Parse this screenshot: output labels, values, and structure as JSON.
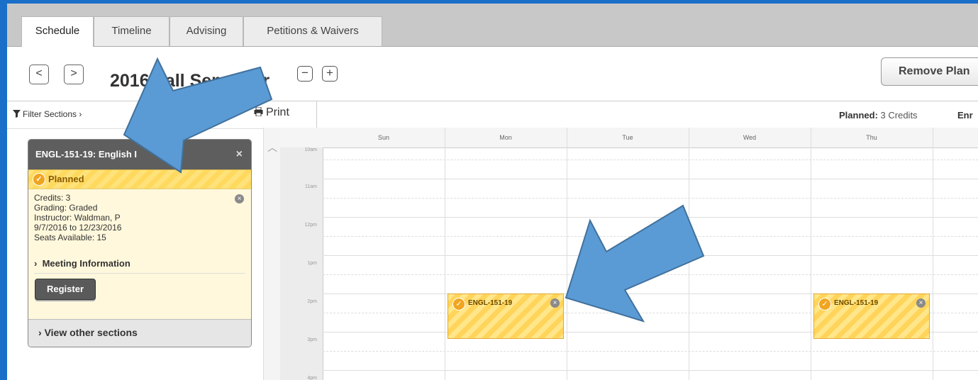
{
  "tabs": [
    {
      "label": "Schedule",
      "active": true
    },
    {
      "label": "Timeline",
      "active": false
    },
    {
      "label": "Advising",
      "active": false
    },
    {
      "label": "Petitions & Waivers",
      "active": false
    }
  ],
  "header": {
    "prev": "<",
    "next": ">",
    "term": "2016 Fall Semester",
    "zoom_out": "−",
    "zoom_in": "+",
    "remove_plan": "Remove Plan"
  },
  "toolbar": {
    "filter": "Filter Sections",
    "print": "Print",
    "planned_label": "Planned:",
    "planned_value": "3 Credits",
    "enrolled_label": "Enr"
  },
  "section_card": {
    "title": "ENGL-151-19: English I",
    "close": "×",
    "status": "Planned",
    "credits": "Credits: 3",
    "grading": "Grading: Graded",
    "instructor": "Instructor: Waldman, P",
    "dates": "9/7/2016 to 12/23/2016",
    "seats": "Seats Available:  15",
    "meeting": "Meeting Information",
    "register": "Register",
    "other_sections": "View other sections"
  },
  "calendar": {
    "days": [
      "Sun",
      "Mon",
      "Tue",
      "Wed",
      "Thu"
    ],
    "times": [
      "10am",
      "11am",
      "12pm",
      "1pm",
      "2pm",
      "3pm",
      "4pm"
    ],
    "events": [
      {
        "label": "ENGL-151-19",
        "day": "Mon",
        "start": "2pm"
      },
      {
        "label": "ENGL-151-19",
        "day": "Thu",
        "start": "2pm"
      }
    ]
  },
  "icons": [
    "chevron-left-icon",
    "chevron-right-icon",
    "minus-icon",
    "plus-icon",
    "filter-icon",
    "printer-icon",
    "check-circle-icon",
    "remove-circle-icon",
    "chevron-up-icon",
    "arrow-annotation"
  ],
  "colors": {
    "frame": "#1a6fc9",
    "planned": "#ffd95e",
    "annotation_arrow": "#5b9bd5"
  }
}
